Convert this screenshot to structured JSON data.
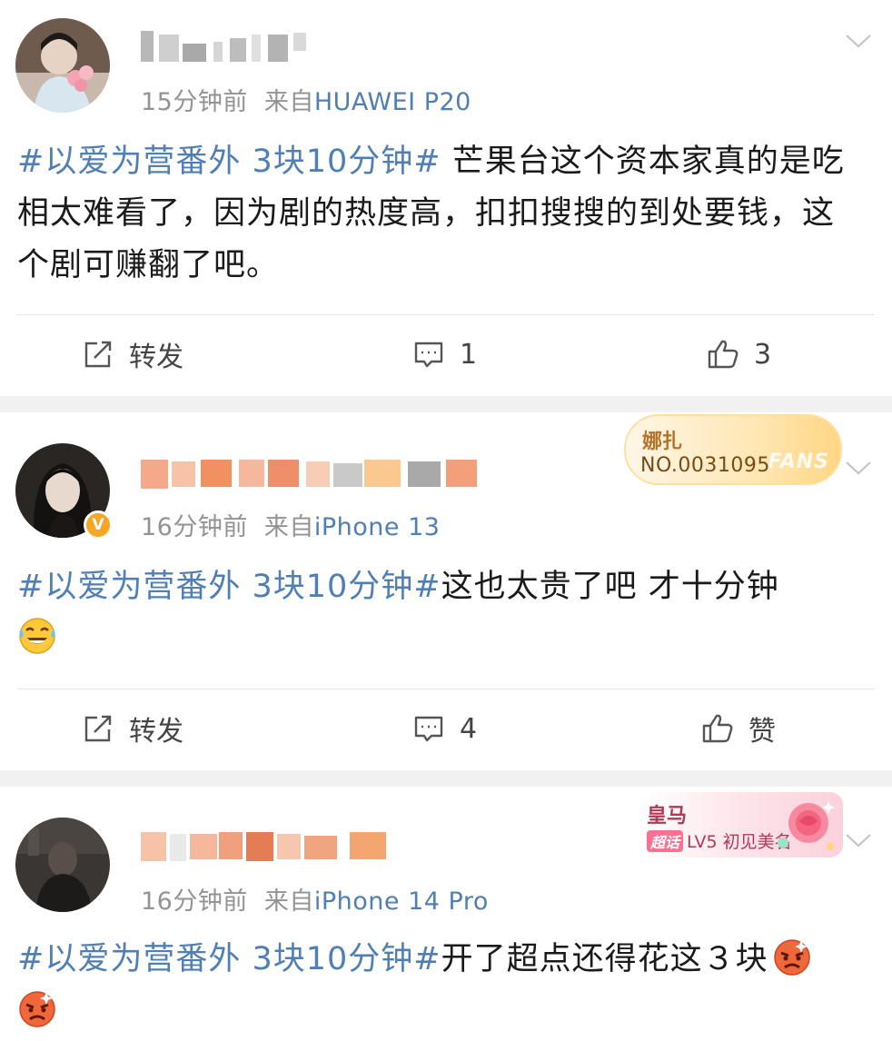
{
  "posts": [
    {
      "time": "15分钟前",
      "source_prefix": "来自",
      "device": "HUAWEI P20",
      "hashtag": "#以爱为营番外 3块10分钟#",
      "text": " 芒果台这个资本家真的是吃相太难看了，因为剧的热度高，扣扣搜搜的到处要钱，这个剧可赚翻了吧。",
      "actions": {
        "repost": "转发",
        "comment": "1",
        "like": "3"
      }
    },
    {
      "time": "16分钟前",
      "source_prefix": "来自",
      "device": "iPhone 13",
      "verified_mark": "V",
      "badge": {
        "name": "娜扎",
        "number": "NO.0031095",
        "fans": "FANS"
      },
      "hashtag": "#以爱为营番外 3块10分钟#",
      "text": "这也太贵了吧 才十分钟",
      "emoji": "laugh-cry-emoji",
      "actions": {
        "repost": "转发",
        "comment": "4",
        "like": "赞"
      }
    },
    {
      "time": "16分钟前",
      "source_prefix": "来自",
      "device": "iPhone 14 Pro",
      "badge": {
        "name": "皇马",
        "chaohua": "超话",
        "level": "LV5 初见美名"
      },
      "hashtag": "#以爱为营番外 3块10分钟#",
      "text": "开了超点还得花这３块",
      "emoji": "angry-emoji"
    }
  ],
  "colors": {
    "link": "#4f7fb4",
    "meta": "#939393",
    "separator": "#f1f1f1",
    "fan_badge": "#ffe7b5",
    "chaohua_badge": "#fbd1dc"
  }
}
